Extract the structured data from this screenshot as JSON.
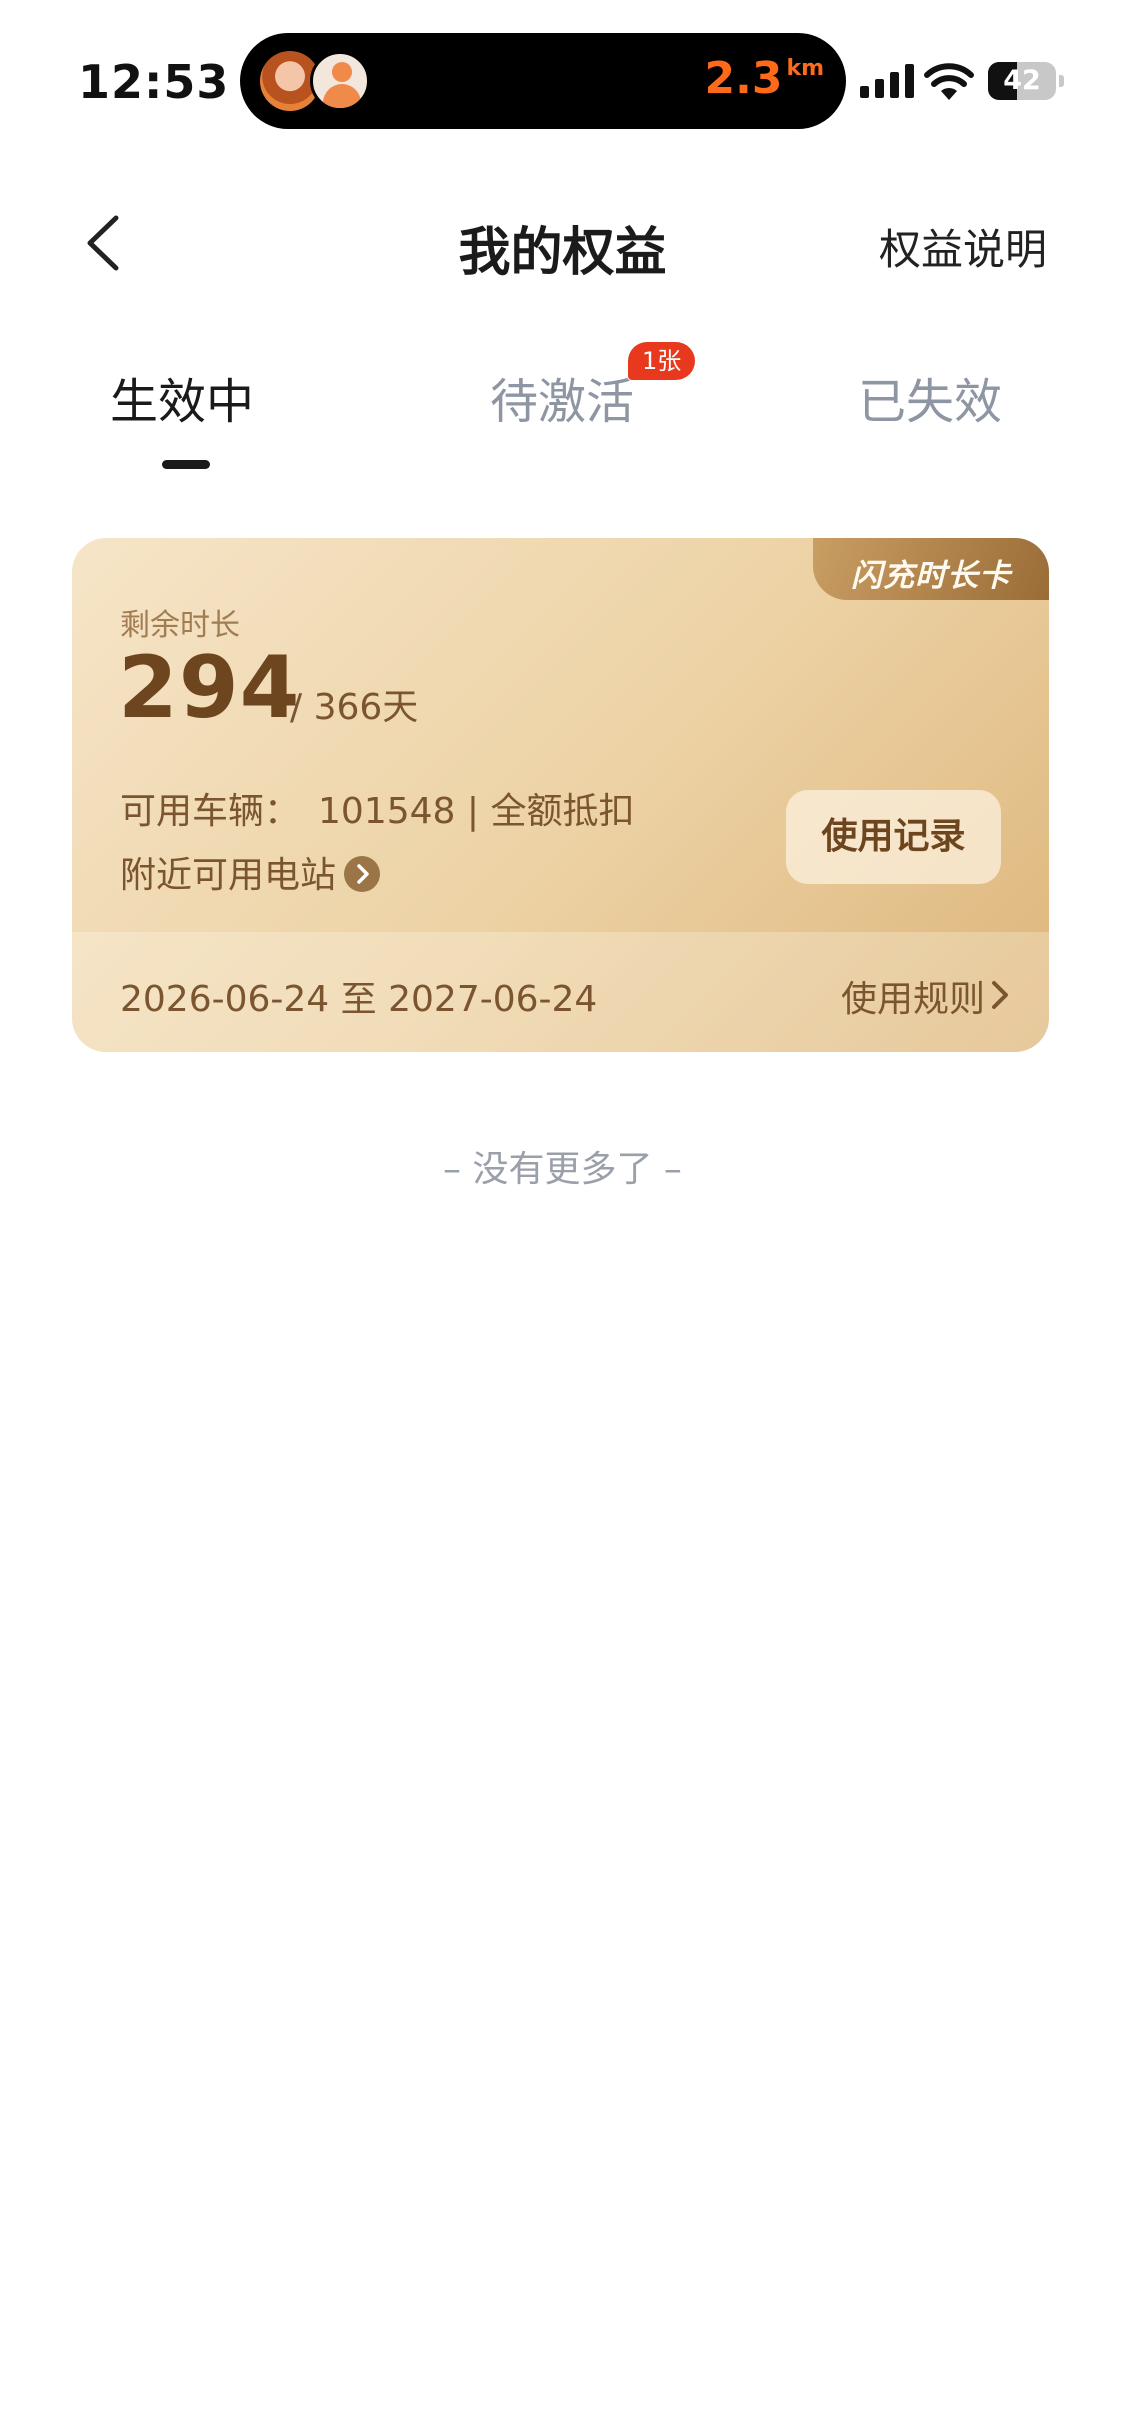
{
  "status_bar": {
    "time": "12:53",
    "live_activity": {
      "distance": "2.3",
      "unit": "km",
      "accent": "#ff6a1a"
    },
    "battery": {
      "level": "42",
      "fraction": 0.42
    },
    "icons": [
      "signal-icon",
      "wifi-icon",
      "battery-icon"
    ]
  },
  "nav": {
    "back_icon": "chevron-left-icon",
    "title": "我的权益",
    "right_link": "权益说明"
  },
  "tabs": [
    {
      "label": "生效中",
      "active": true
    },
    {
      "label": "待激活",
      "active": false,
      "badge": "1张"
    },
    {
      "label": "已失效",
      "active": false
    }
  ],
  "card": {
    "tag": "闪充时长卡",
    "remaining_label": "剩余时长",
    "remaining_value": "294",
    "total": "/ 366天",
    "vehicle_label": "可用车辆：",
    "vehicle_value": "101548 | 全额抵扣",
    "nearby_link": "附近可用电站",
    "record_button": "使用记录",
    "date_range": "2026-06-24 至 2027-06-24",
    "rules_link": "使用规则",
    "colors": {
      "primary_text": "#6d451f",
      "secondary_text": "#7b5530",
      "tag_bg": "#9a6c37"
    }
  },
  "list_end": "– 没有更多了 –"
}
